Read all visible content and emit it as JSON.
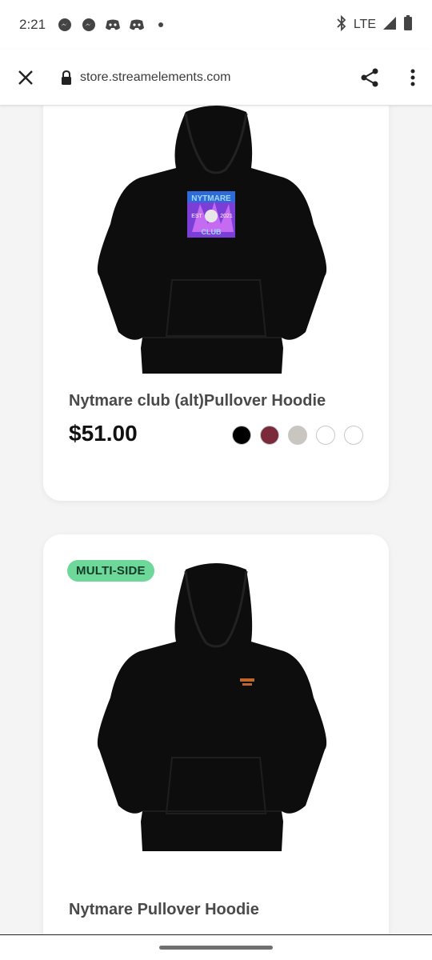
{
  "status_bar": {
    "time": "2:21",
    "network": "LTE",
    "notification_icons": [
      "messenger-icon",
      "messenger-icon",
      "discord-icon",
      "discord-icon",
      "dot-icon"
    ],
    "right_icons": [
      "bluetooth-icon",
      "signal-icon",
      "battery-icon"
    ]
  },
  "browser": {
    "url": "store.streamelements.com",
    "icons": [
      "close-icon",
      "lock-icon",
      "share-icon",
      "more-vert-icon"
    ]
  },
  "products": [
    {
      "name": "Nytmare club (alt)Pullover Hoodie",
      "price": "$51.00",
      "badge": "",
      "print_text": [
        "NYTMARE",
        "EST",
        "2021",
        "CLUB"
      ],
      "swatches": [
        "#000000",
        "#7a2a3a",
        "#c9c6c0",
        "#ffffff",
        "#ffffff"
      ]
    },
    {
      "name": "Nytmare Pullover Hoodie",
      "price": "",
      "badge": "MULTI-SIDE",
      "swatches": []
    }
  ]
}
